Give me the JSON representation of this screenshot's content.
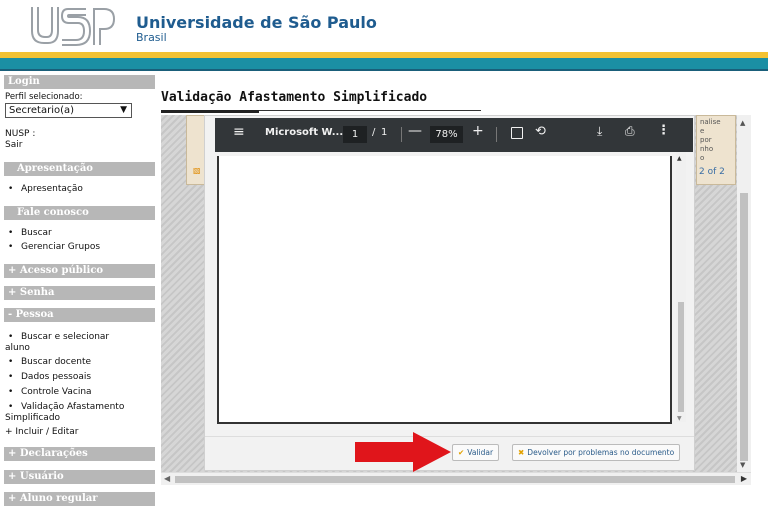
{
  "header": {
    "university": "Universidade de São Paulo",
    "country": "Brasil",
    "logo_text": "USP"
  },
  "sidebar": {
    "login_head": "Login",
    "perfil_label": "Perfil selecionado:",
    "perfil_value": "Secretario(a)",
    "nusp_label": "NUSP :",
    "sair": "Sair",
    "sections": {
      "apresentacao": {
        "head": "Apresentação",
        "items": [
          "Apresentação"
        ]
      },
      "fale": {
        "head": "Fale conosco",
        "items": [
          "Buscar",
          "Gerenciar Grupos"
        ]
      },
      "acesso": {
        "head": "+ Acesso público"
      },
      "senha": {
        "head": "+ Senha"
      },
      "pessoa": {
        "head": "- Pessoa",
        "items": [
          "Buscar e selecionar",
          "aluno",
          "Buscar docente",
          "Dados pessoais",
          "Controle Vacina",
          "Validação Afastamento",
          "Simplificado"
        ],
        "incluir": "+ Incluir / Editar"
      },
      "declaracoes": {
        "head": "+ Declarações"
      },
      "usuario": {
        "head": "+ Usuário"
      },
      "aluno": {
        "head": "+ Aluno regular"
      }
    },
    "bullet": "•"
  },
  "main": {
    "title": "Validação Afastamento Simplificado"
  },
  "background_doc": {
    "snippet": [
      "nalise",
      "e",
      "por",
      "nho",
      "o"
    ],
    "page_count": "2 of 2"
  },
  "pdf_viewer": {
    "menu_icon": "≡",
    "title": "Microsoft W...",
    "page_current": "1",
    "page_sep": "/",
    "page_total": "1",
    "zoom_minus": "—",
    "zoom": "78%",
    "zoom_plus": "+",
    "rotate_icon": "⟲",
    "download_icon": "⤓",
    "print_icon": "⎙",
    "more_icon": "⋮"
  },
  "buttons": {
    "validar": "Validar",
    "validar_icon": "✔",
    "devolver": "Devolver por problemas no documento",
    "devolver_icon": "✖"
  },
  "colors": {
    "brand_blue": "#1f5c8f",
    "band_yellow": "#f3c233",
    "band_teal": "#1b8fa4",
    "arrow_red": "#e0151b"
  }
}
